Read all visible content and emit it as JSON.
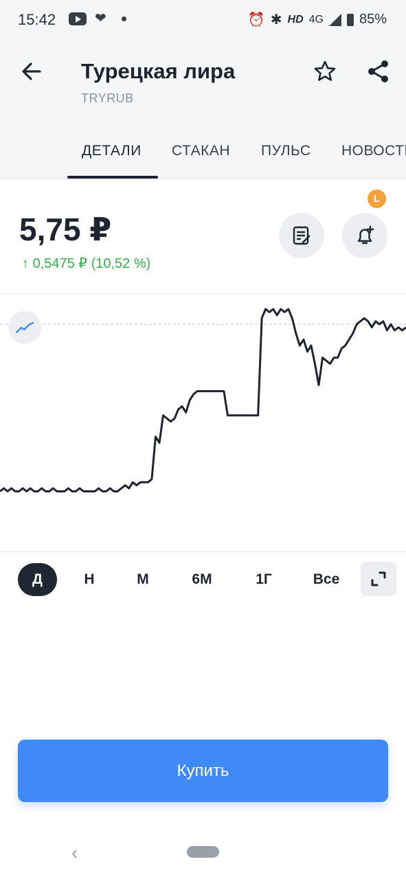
{
  "status_bar": {
    "time": "15:42",
    "icons": [
      "youtube-icon",
      "heart-icon",
      "dot-icon",
      "alarm-icon",
      "bluetooth-icon"
    ],
    "hd": "HD",
    "network": "4G",
    "battery": "85%"
  },
  "header": {
    "title": "Турецкая лира",
    "ticker": "TRYRUB",
    "tabs": [
      {
        "label": "ДЕТАЛИ",
        "active": true
      },
      {
        "label": "СТАКАН",
        "active": false
      },
      {
        "label": "ПУЛЬС",
        "active": false
      },
      {
        "label": "НОВОСТИ",
        "active": false
      }
    ]
  },
  "quote": {
    "price": "5,75 ₽",
    "change": "0,5475 ₽ (10,52 %)",
    "badge": "L"
  },
  "colors": {
    "accent": "#4289f8",
    "positive": "#2fb24a",
    "dark": "#1f2430",
    "badge": "#f6a13a"
  },
  "chart_data": {
    "type": "line",
    "reference_line": 5.75,
    "ylim": [
      5.0,
      5.85
    ],
    "grid": false,
    "y": [
      5.2,
      5.21,
      5.2,
      5.21,
      5.2,
      5.2,
      5.21,
      5.2,
      5.21,
      5.2,
      5.2,
      5.21,
      5.2,
      5.2,
      5.21,
      5.2,
      5.2,
      5.2,
      5.21,
      5.2,
      5.2,
      5.21,
      5.2,
      5.2,
      5.2,
      5.2,
      5.21,
      5.2,
      5.2,
      5.21,
      5.2,
      5.2,
      5.21,
      5.22,
      5.21,
      5.23,
      5.22,
      5.23,
      5.23,
      5.23,
      5.24,
      5.38,
      5.36,
      5.45,
      5.44,
      5.43,
      5.44,
      5.47,
      5.48,
      5.46,
      5.5,
      5.52,
      5.53,
      5.53,
      5.53,
      5.53,
      5.53,
      5.53,
      5.53,
      5.53,
      5.45,
      5.45,
      5.45,
      5.45,
      5.45,
      5.45,
      5.45,
      5.45,
      5.45,
      5.77,
      5.8,
      5.79,
      5.8,
      5.78,
      5.8,
      5.79,
      5.8,
      5.77,
      5.72,
      5.68,
      5.7,
      5.66,
      5.68,
      5.62,
      5.55,
      5.64,
      5.63,
      5.62,
      5.64,
      5.64,
      5.67,
      5.68,
      5.7,
      5.72,
      5.75,
      5.76,
      5.77,
      5.76,
      5.74,
      5.76,
      5.75,
      5.76,
      5.73,
      5.75,
      5.73,
      5.74,
      5.73,
      5.74
    ]
  },
  "periods": [
    {
      "label": "Д",
      "active": true
    },
    {
      "label": "Н",
      "active": false
    },
    {
      "label": "М",
      "active": false
    },
    {
      "label": "6М",
      "active": false
    },
    {
      "label": "1Г",
      "active": false
    },
    {
      "label": "Все",
      "active": false
    }
  ],
  "buy_button": {
    "label": "Купить"
  },
  "nav": {
    "back": "‹"
  }
}
